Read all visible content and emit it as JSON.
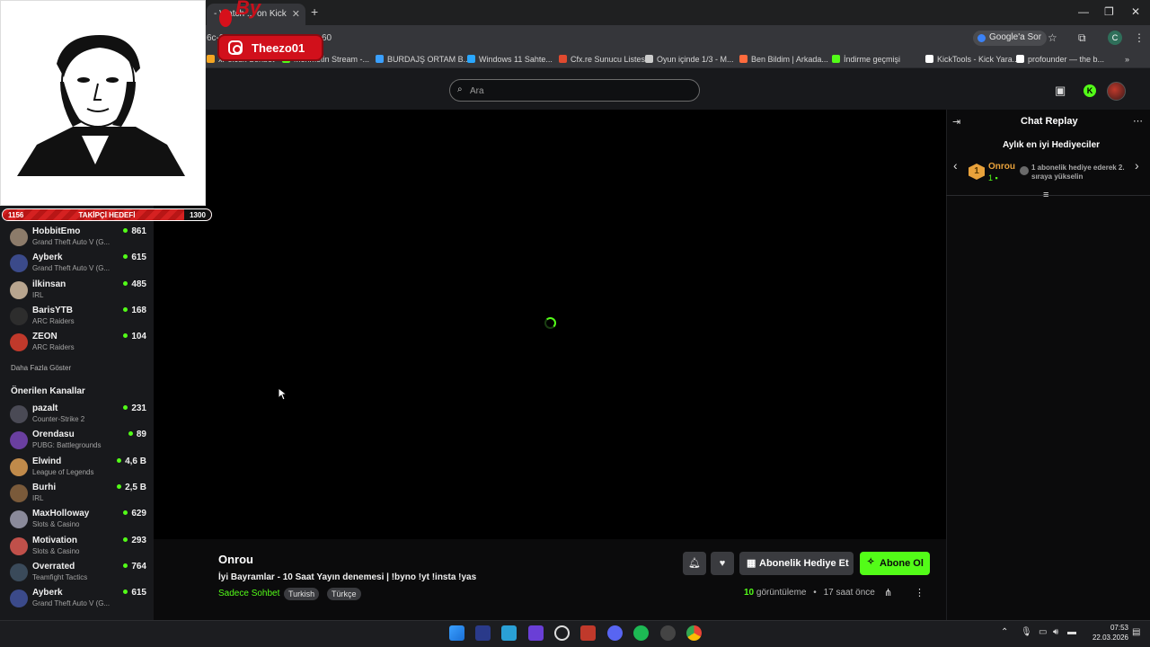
{
  "browser": {
    "tab_title": "- Watch ... on Kick",
    "url_fragment": "6c-0",
    "url_tail": "60",
    "google_btn": "Google'a Sor",
    "profile_letter": "C",
    "bookmarks": [
      {
        "label": "xPolcuk Sohbet",
        "color": "#f5a623"
      },
      {
        "label": "Mehmetin Stream -...",
        "color": "#53fc18"
      },
      {
        "label": "BURDAJŞ ORTAM B...",
        "color": "#3aa0ff"
      },
      {
        "label": "Windows 11 Sahte...",
        "color": "#2aa7ff"
      },
      {
        "label": "Cfx.re Sunucu Listesi",
        "color": "#e04a2f"
      },
      {
        "label": "Oyun içinde 1/3 - M...",
        "color": "#cccccc"
      },
      {
        "label": "Ben Bildim | Arkada...",
        "color": "#ff6b3d"
      },
      {
        "label": "İndirme geçmişi",
        "color": "#53fc18"
      },
      {
        "label": "KickTools - Kick Yara...",
        "color": "#ffffff"
      },
      {
        "label": "profounder — the b...",
        "color": "#ffffff"
      }
    ]
  },
  "overlay": {
    "brand": "By",
    "instagram": "Theezo01",
    "follow_current": "1156",
    "follow_label": "TAKİPÇİ HEDEFİ",
    "follow_target": "1300",
    "follow_progress": 0.887
  },
  "header": {
    "search_placeholder": "Ara"
  },
  "sidebar": {
    "followed": [
      {
        "name": "HobbitEmo",
        "game": "Grand Theft Auto V (G...",
        "viewers": "861",
        "color": "#8c7b6a"
      },
      {
        "name": "Ayberk",
        "game": "Grand Theft Auto V (G...",
        "viewers": "615",
        "color": "#3b4a8a"
      },
      {
        "name": "ilkinsan",
        "game": "IRL",
        "viewers": "485",
        "color": "#b8a58f"
      },
      {
        "name": "BarisYTB",
        "game": "ARC Raiders",
        "viewers": "168",
        "color": "#2d2d2d"
      },
      {
        "name": "ZEON",
        "game": "ARC Raiders",
        "viewers": "104",
        "color": "#c0392b"
      }
    ],
    "show_more": "Daha Fazla Göster",
    "recommended_title": "Önerilen Kanallar",
    "recommended": [
      {
        "name": "pazalt",
        "game": "Counter-Strike 2",
        "viewers": "231",
        "color": "#4a4a55"
      },
      {
        "name": "Orendasu",
        "game": "PUBG: Battlegrounds",
        "viewers": "89",
        "color": "#6a3fa0"
      },
      {
        "name": "Elwind",
        "game": "League of Legends",
        "viewers": "4,6 B",
        "color": "#c08a4a"
      },
      {
        "name": "Burhi",
        "game": "IRL",
        "viewers": "2,5 B",
        "color": "#7a5a3a"
      },
      {
        "name": "MaxHolloway",
        "game": "Slots & Casino",
        "viewers": "629",
        "color": "#8a8a9a"
      },
      {
        "name": "Motivation",
        "game": "Slots & Casino",
        "viewers": "293",
        "color": "#c0504a"
      },
      {
        "name": "Overrated",
        "game": "Teamfight Tactics",
        "viewers": "764",
        "color": "#3a4a5a"
      },
      {
        "name": "Ayberk",
        "game": "Grand Theft Auto V (G...",
        "viewers": "615",
        "color": "#3b4a8a"
      }
    ]
  },
  "stream": {
    "channel": "Onrou",
    "title": "İyi Bayramlar - 10 Saat Yayın denemesi | !byno !yt !insta !yas",
    "chat_mode": "Sadece Sohbet",
    "tags": [
      "Turkish",
      "Türkçe"
    ],
    "gift_label": "Abonelik Hediye Et",
    "subscribe_label": "Abone Ol",
    "views": "10",
    "views_label": "görüntüleme",
    "ago": "17 saat önce"
  },
  "chat": {
    "title": "Chat Replay",
    "leaderboard_title": "Aylık en iyi Hediyeciler",
    "rank": "1",
    "top_name": "Onrou",
    "top_count": "1",
    "hint": "1 abonelik hediye ederek 2. sıraya yükselin"
  },
  "taskbar": {
    "time": "07:53",
    "date": "22.03.2026"
  }
}
